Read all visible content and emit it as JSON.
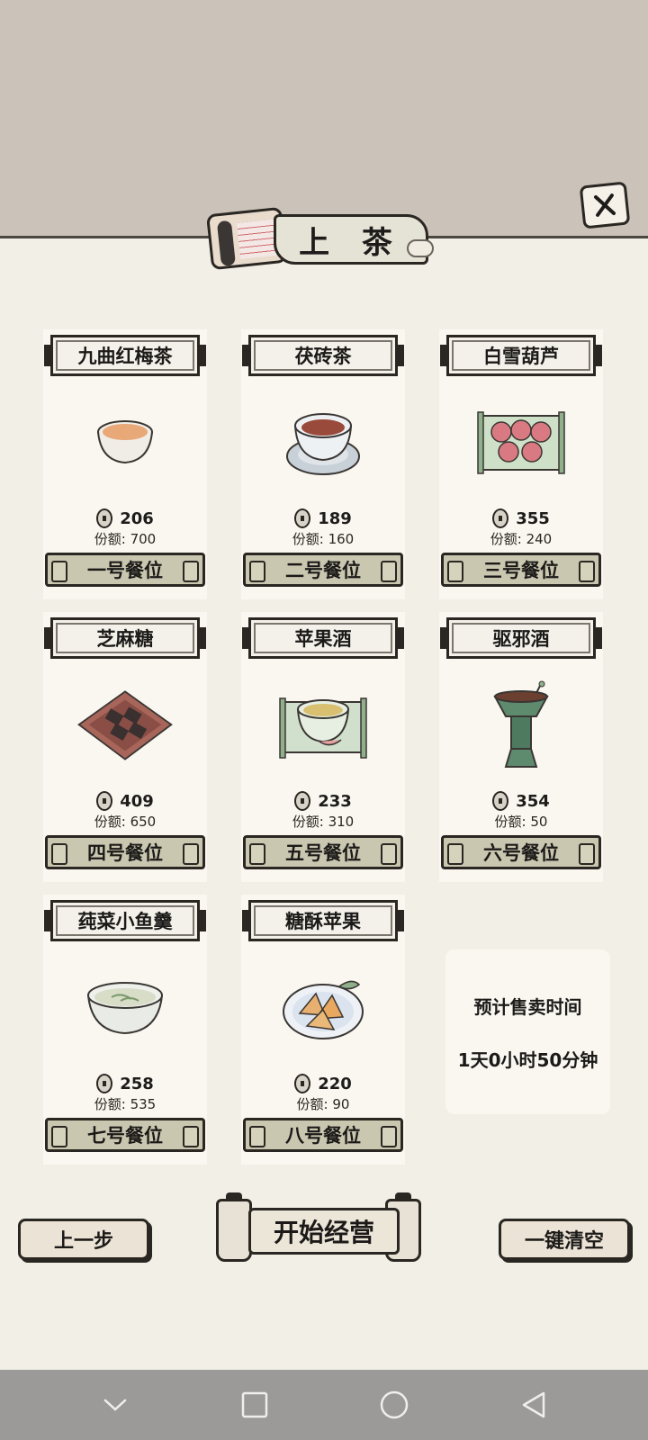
{
  "header": {
    "title": "上 茶"
  },
  "items": [
    {
      "name": "九曲红梅茶",
      "price": "206",
      "quota": "份额: 700",
      "seat": "一号餐位",
      "icon": "tea-cup-icon"
    },
    {
      "name": "茯砖茶",
      "price": "189",
      "quota": "份额: 160",
      "seat": "二号餐位",
      "icon": "tea-saucer-icon"
    },
    {
      "name": "白雪葫芦",
      "price": "355",
      "quota": "份额: 240",
      "seat": "三号餐位",
      "icon": "haws-tray-icon"
    },
    {
      "name": "芝麻糖",
      "price": "409",
      "quota": "份额: 650",
      "seat": "四号餐位",
      "icon": "sesame-candy-icon"
    },
    {
      "name": "苹果酒",
      "price": "233",
      "quota": "份额: 310",
      "seat": "五号餐位",
      "icon": "cider-bowl-icon"
    },
    {
      "name": "驱邪酒",
      "price": "354",
      "quota": "份额: 50",
      "seat": "六号餐位",
      "icon": "bronze-vessel-icon"
    },
    {
      "name": "莼菜小鱼羹",
      "price": "258",
      "quota": "份额: 535",
      "seat": "七号餐位",
      "icon": "soup-bowl-icon"
    },
    {
      "name": "糖酥苹果",
      "price": "220",
      "quota": "份额: 90",
      "seat": "八号餐位",
      "icon": "apple-pastry-icon"
    }
  ],
  "info": {
    "title": "预计售卖时间",
    "value": "1天0小时50分钟"
  },
  "buttons": {
    "prev": "上一步",
    "start": "开始经营",
    "clear": "一键清空"
  }
}
